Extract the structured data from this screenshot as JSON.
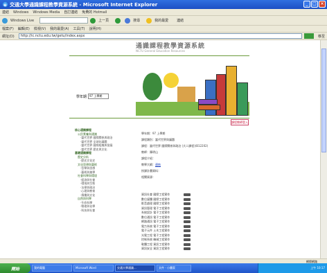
{
  "window": {
    "title": "交通大學通識課程教學資源系統 - Microsoft Internet Explorer"
  },
  "links_bar": {
    "items": [
      "連結",
      "Windows",
      "Windows Media",
      "自訂連結",
      "免費的 Hotmail"
    ]
  },
  "toolbar": {
    "live_label": "Windows Live",
    "back_label": "上一頁",
    "search_label": "搜尋",
    "favorites_label": "我的最愛",
    "links_label": "連結"
  },
  "menu": {
    "items": [
      "檔案(F)",
      "編輯(E)",
      "檢視(V)",
      "我的最愛(A)",
      "工具(T)",
      "說明(H)"
    ]
  },
  "address": {
    "label": "網址(D)",
    "url": "http://ic.nctu.edu.tw/getu/index.aspx",
    "go_label": "移至"
  },
  "banner": {
    "title": "通識課程教學資源系統",
    "subtitle": "NCTU General Education Resources"
  },
  "sidebar": {
    "semester_label": "學年期",
    "semester_value": "97 上學期",
    "tree": [
      {
        "level": 1,
        "text": "核心通識課程"
      },
      {
        "level": 2,
        "text": "公民素養與通識"
      },
      {
        "level": 3,
        "text": "‧當代世界 國際關係與政治"
      },
      {
        "level": 3,
        "text": "‧當代世界 全球化議題"
      },
      {
        "level": 3,
        "text": "‧當代世界 國際組織與發展"
      },
      {
        "level": 3,
        "text": "‧當代世界 歷史與文化"
      },
      {
        "level": 1,
        "text": "基礎通識課程"
      },
      {
        "level": 2,
        "text": "歷史分析"
      },
      {
        "level": 3,
        "text": "‧歷史文化史"
      },
      {
        "level": 2,
        "text": "文化思想與藝術"
      },
      {
        "level": 3,
        "text": "‧哲學與思想"
      },
      {
        "level": 3,
        "text": "‧藝術與美學"
      },
      {
        "level": 2,
        "text": "社會科學與環境"
      },
      {
        "level": 3,
        "text": "‧經濟與社會"
      },
      {
        "level": 3,
        "text": "‧環境與生態"
      },
      {
        "level": 3,
        "text": "‧法律與政治"
      },
      {
        "level": 3,
        "text": "‧心理與教育"
      },
      {
        "level": 3,
        "text": "‧傳播與文化"
      },
      {
        "level": 2,
        "text": "自然與科學"
      },
      {
        "level": 3,
        "text": "‧生命科學"
      },
      {
        "level": 3,
        "text": "‧物理與化學"
      },
      {
        "level": 3,
        "text": "‧科技與社會"
      }
    ]
  },
  "main": {
    "login_button": "課程教師登入",
    "info": [
      {
        "text": "學年期：97 上學期"
      },
      {
        "text": "課程類別：當代世界與議題"
      },
      {
        "text": "課程：當代世界 國際關係與政治 (大二課程)(B12202)"
      },
      {
        "text": "教師：陳明山"
      },
      {
        "text": "課程介紹："
      },
      {
        "text": "教學大綱：",
        "link": "連結"
      },
      {
        "text": "授課計畫資料："
      },
      {
        "text": "相關資源："
      }
    ],
    "courses": [
      {
        "name": "資訊社會 國際工程實作"
      },
      {
        "name": "數位媒體 國際工程實作"
      },
      {
        "name": "影音處理 國際工程實作"
      },
      {
        "name": "資訊管理 電子工程實作"
      },
      {
        "name": "系統設計 電子工程實作"
      },
      {
        "name": "數位通訊 電子工程實作"
      },
      {
        "name": "網路通訊 電子工程實作"
      },
      {
        "name": "電力系統 電子工程實作"
      },
      {
        "name": "電子元件 土木工程實作"
      },
      {
        "name": "光電工程 電子工程實作"
      },
      {
        "name": "控制系統 機械工程實作"
      },
      {
        "name": "軟體工程 資訊工程實作"
      },
      {
        "name": "資訊安全 資訊工程實作"
      }
    ]
  },
  "status": {
    "zone": "網際網路"
  },
  "taskbar": {
    "start": "開始",
    "tasks": [
      "我的電腦",
      "Microsoft Word",
      "交通大學通識...",
      "文件 - 小畫家"
    ],
    "clock": "上午 10:17"
  },
  "colors": {
    "title_bar": "#1c4fc4",
    "accent_green": "#3a6b2a",
    "link_blue": "#1a3fbf",
    "login_red": "#c24"
  }
}
